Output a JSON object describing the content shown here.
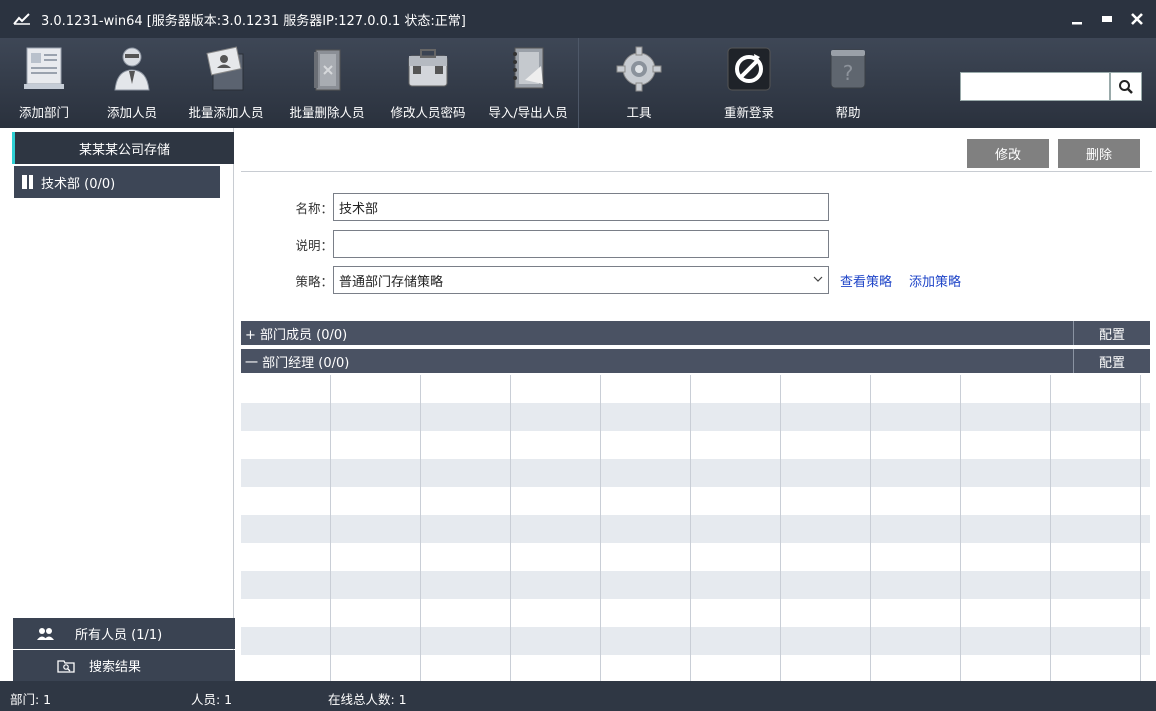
{
  "window": {
    "title": "3.0.1231-win64 [服务器版本:3.0.1231 服务器IP:127.0.0.1 状态:正常]",
    "minimize": "_",
    "maximize": "▬",
    "close": "✕"
  },
  "toolbar": {
    "items": [
      {
        "label": "添加部门",
        "icon": "add-department-icon"
      },
      {
        "label": "添加人员",
        "icon": "add-person-icon"
      },
      {
        "label": "批量添加人员",
        "icon": "batch-add-icon"
      },
      {
        "label": "批量删除人员",
        "icon": "batch-delete-icon"
      },
      {
        "label": "修改人员密码",
        "icon": "change-password-icon"
      },
      {
        "label": "导入/导出人员",
        "icon": "import-export-icon"
      },
      {
        "label": "工具",
        "icon": "tools-gear-icon"
      },
      {
        "label": "重新登录",
        "icon": "relogin-icon"
      },
      {
        "label": "帮助",
        "icon": "help-icon"
      }
    ],
    "search_value": ""
  },
  "sidebar": {
    "company": "某某某公司存储",
    "departments": [
      {
        "label": "技术部 (0/0)"
      }
    ],
    "all_users": "所有人员 (1/1)",
    "search_results": "搜索结果"
  },
  "detail": {
    "edit_button": "修改",
    "delete_button": "删除",
    "name_label": "名称：",
    "name_value": "技术部",
    "desc_label": "说明：",
    "desc_value": "",
    "policy_label": "策略：",
    "policy_value": "普通部门存储策略",
    "view_policy": "查看策略",
    "add_policy": "添加策略",
    "members_section": "+ 部门成员 (0/0)",
    "managers_section": "一 部门经理 (0/0)",
    "config_label": "配置"
  },
  "statusbar": {
    "departments": "部门: 1",
    "users": "人员: 1",
    "online": "在线总人数: 1"
  }
}
